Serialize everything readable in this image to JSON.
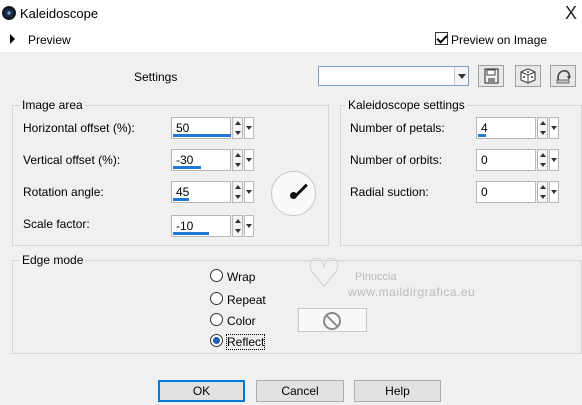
{
  "window": {
    "title": "Kaleidoscope",
    "close": "X"
  },
  "preview": {
    "label": "Preview",
    "preview_on_image": "Preview on Image",
    "preview_on_image_checked": true
  },
  "toolbar": {
    "settings_label": "Settings",
    "preset_value": ""
  },
  "image_area": {
    "title": "Image area",
    "horizontal_offset": {
      "label": "Horizontal offset (%):",
      "value": "50"
    },
    "vertical_offset": {
      "label": "Vertical offset (%):",
      "value": "-30"
    },
    "rotation_angle": {
      "label": "Rotation angle:",
      "value": "45"
    },
    "scale_factor": {
      "label": "Scale factor:",
      "value": "-10"
    }
  },
  "kaleidoscope_settings": {
    "title": "Kaleidoscope settings",
    "number_of_petals": {
      "label": "Number of petals:",
      "value": "4"
    },
    "number_of_orbits": {
      "label": "Number of orbits:",
      "value": "0"
    },
    "radial_suction": {
      "label": "Radial suction:",
      "value": "0"
    }
  },
  "edge_mode": {
    "title": "Edge mode",
    "options": [
      "Wrap",
      "Repeat",
      "Color",
      "Reflect"
    ],
    "selected": "Reflect"
  },
  "watermark": {
    "name": "Pinuccia",
    "url": "www.maildirgrafica.eu"
  },
  "buttons": {
    "ok": "OK",
    "cancel": "Cancel",
    "help": "Help"
  }
}
